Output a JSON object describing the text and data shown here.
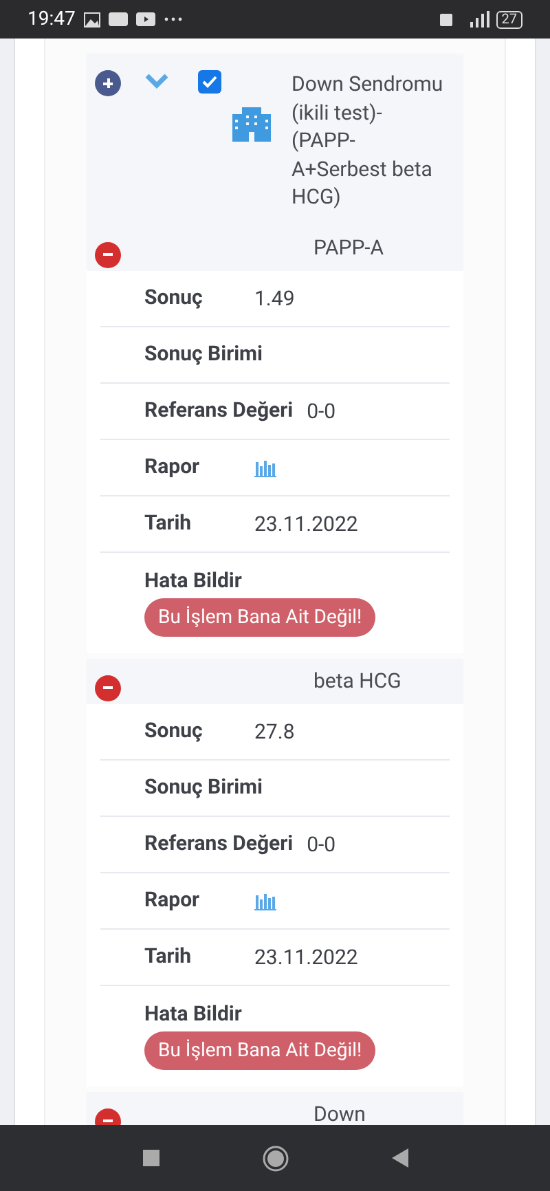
{
  "status_bar": {
    "time": "19:47",
    "battery": "27"
  },
  "test": {
    "expanded": true,
    "checked": true,
    "name": "Down Sendromu (ikili test)-(PAPP-A+Serbest beta HCG)"
  },
  "results": [
    {
      "name": "PAPP-A",
      "expanded": true,
      "rows": [
        {
          "kind": "text",
          "label": "Sonuç",
          "value": "1.49"
        },
        {
          "kind": "text",
          "label": "Sonuç Birimi"
        },
        {
          "kind": "text",
          "label": "Referans Değeri",
          "value": "0-0"
        },
        {
          "kind": "chart",
          "label": "Rapor"
        },
        {
          "kind": "text",
          "label": "Tarih",
          "value": "23.11.2022"
        },
        {
          "kind": "action",
          "label": "Hata Bildir",
          "button": "Bu İşlem Bana Ait Değil!"
        }
      ]
    },
    {
      "name": "beta HCG",
      "expanded": true,
      "rows": [
        {
          "kind": "text",
          "label": "Sonuç",
          "value": "27.8"
        },
        {
          "kind": "text",
          "label": "Sonuç Birimi"
        },
        {
          "kind": "text",
          "label": "Referans Değeri",
          "value": "0-0"
        },
        {
          "kind": "chart",
          "label": "Rapor"
        },
        {
          "kind": "text",
          "label": "Tarih",
          "value": "23.11.2022"
        },
        {
          "kind": "action",
          "label": "Hata Bildir",
          "button": "Bu İşlem Bana Ait Değil!"
        }
      ]
    },
    {
      "name": "Down",
      "expanded": true
    }
  ]
}
